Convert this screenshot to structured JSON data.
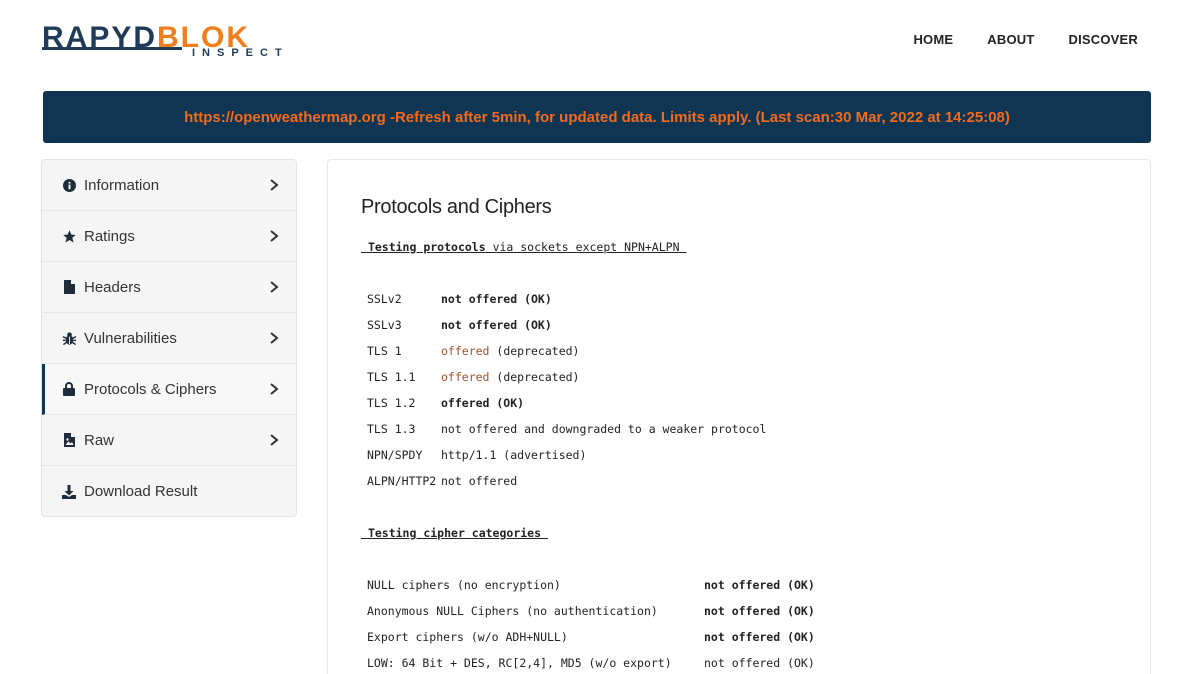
{
  "logo": {
    "part1": "RAPYD",
    "part2": "BLOK",
    "sub": "INSPECT"
  },
  "nav": {
    "home": "HOME",
    "about": "ABOUT",
    "discover": "DISCOVER"
  },
  "banner": {
    "text": "https://openweathermap.org -Refresh after 5min, for updated data. Limits apply. (Last scan:30 Mar, 2022 at 14:25:08)"
  },
  "sidebar": {
    "items": [
      {
        "label": "Information",
        "icon": "info-circle-icon"
      },
      {
        "label": "Ratings",
        "icon": "star-icon"
      },
      {
        "label": "Headers",
        "icon": "file-icon"
      },
      {
        "label": "Vulnerabilities",
        "icon": "bug-icon"
      },
      {
        "label": "Protocols & Ciphers",
        "icon": "lock-icon",
        "active": true
      },
      {
        "label": "Raw",
        "icon": "file-image-icon"
      },
      {
        "label": "Download Result",
        "icon": "download-icon"
      }
    ]
  },
  "main": {
    "title": "Protocols and Ciphers",
    "section1": {
      "bold": "Testing protocols",
      "rest": " via sockets except NPN+ALPN "
    },
    "protocols": [
      {
        "name": "SSLv2",
        "status": "not offered (OK)",
        "style": "green-b"
      },
      {
        "name": "SSLv3",
        "status": "not offered (OK)",
        "style": "green-b"
      },
      {
        "name": "TLS 1",
        "status_a": "offered",
        "status_b": " (deprecated)",
        "style": "brown"
      },
      {
        "name": "TLS 1.1",
        "status_a": "offered",
        "status_b": " (deprecated)",
        "style": "brown"
      },
      {
        "name": "TLS 1.2",
        "status": "offered (OK)",
        "style": "green-b"
      },
      {
        "name": "TLS 1.3",
        "status": "not offered and downgraded to a weaker protocol",
        "style": "plain"
      },
      {
        "name": "NPN/SPDY",
        "status": "http/1.1 (advertised)",
        "style": "plain"
      },
      {
        "name": "ALPN/HTTP2",
        "status": "not offered",
        "style": "plain"
      }
    ],
    "section2": {
      "bold": "Testing cipher categories"
    },
    "ciphers": [
      {
        "name": "NULL ciphers (no encryption)",
        "status": "not offered (OK)",
        "style": "green-b"
      },
      {
        "name": "Anonymous NULL Ciphers (no authentication)",
        "status": "not offered (OK)",
        "style": "green-b"
      },
      {
        "name": "Export ciphers (w/o ADH+NULL)",
        "status": "not offered (OK)",
        "style": "green-b"
      },
      {
        "name": "LOW: 64 Bit + DES, RC[2,4], MD5 (w/o export)",
        "status": "not offered (OK)",
        "style": "green"
      }
    ]
  },
  "colors": {
    "brand_dark": "#0f3553",
    "brand_orange": "#f26b1d",
    "ok_green": "#1d7a1d",
    "warn_brown": "#a0522d"
  }
}
